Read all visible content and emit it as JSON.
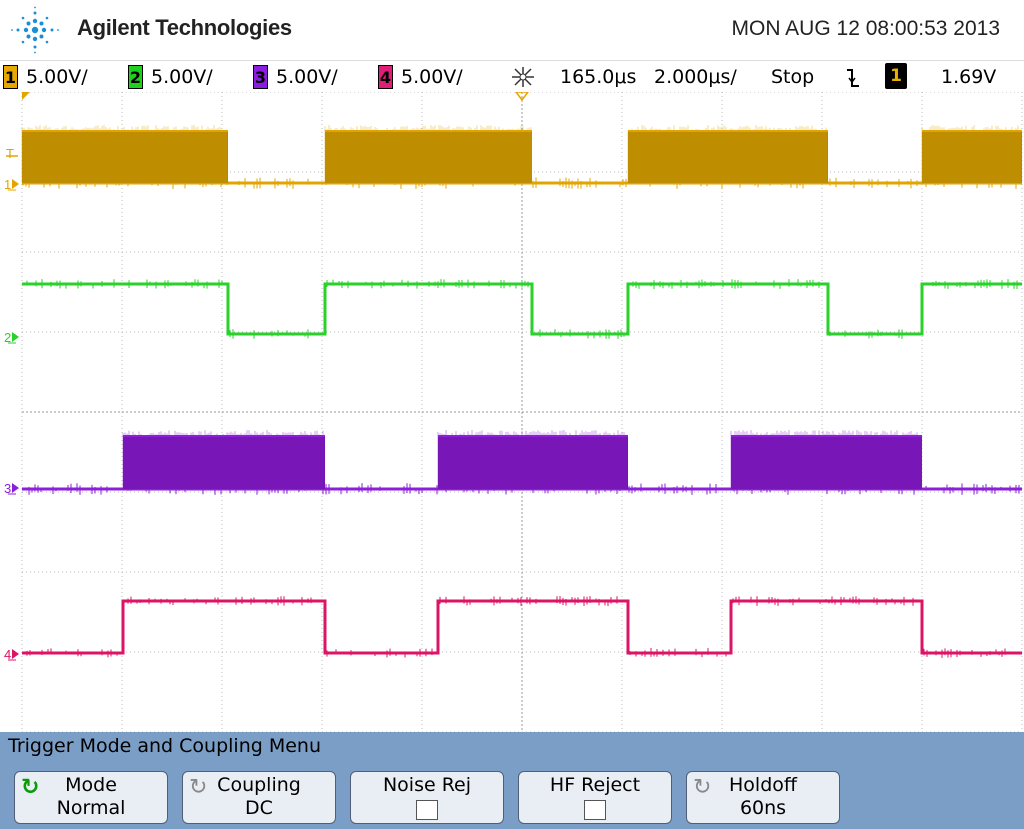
{
  "header": {
    "brand": "Agilent Technologies",
    "datetime": "MON AUG 12 08:00:53 2013",
    "logo_icon": "agilent-spark-icon"
  },
  "statusbar": {
    "channels": [
      {
        "num": "1",
        "scale": "5.00V/",
        "color": "#e6a800"
      },
      {
        "num": "2",
        "scale": "5.00V/",
        "color": "#1fd01f"
      },
      {
        "num": "3",
        "scale": "5.00V/",
        "color": "#8a1de0"
      },
      {
        "num": "4",
        "scale": "5.00V/",
        "color": "#e01e78"
      }
    ],
    "delay": "165.0μs",
    "timebase": "2.000μs/",
    "run_state": "Stop",
    "trigger_slope_icon": "falling-edge-icon",
    "trigger_source": "1",
    "trigger_level": "1.69V"
  },
  "scope": {
    "grid_color": "#b8b8b8",
    "marker_labels": {
      "trigger": "T",
      "ch1": "1",
      "ch2": "2",
      "ch3": "3",
      "ch4": "4"
    },
    "traces": [
      {
        "name": "ch1",
        "color": "#e2a400",
        "fill_color": "#b48700",
        "type": "burst"
      },
      {
        "name": "ch2",
        "color": "#28d228",
        "type": "square"
      },
      {
        "name": "ch3",
        "color": "#8c1fd8",
        "fill_color": "#7414b0",
        "type": "burst"
      },
      {
        "name": "ch4",
        "color": "#dc1466",
        "type": "square"
      }
    ]
  },
  "menu": {
    "title": "Trigger Mode and Coupling Menu",
    "softkeys": [
      {
        "name": "mode",
        "line1": "Mode",
        "line2": "Normal",
        "icon": "rotate-knob-icon"
      },
      {
        "name": "coupling",
        "line1": "Coupling",
        "line2": "DC",
        "icon": "rotate-knob-icon"
      },
      {
        "name": "noise-rej",
        "line1": "Noise Rej",
        "line2": ""
      },
      {
        "name": "hf-reject",
        "line1": "HF Reject",
        "line2": ""
      },
      {
        "name": "holdoff",
        "line1": "Holdoff",
        "line2": "60ns",
        "icon": "rotate-knob-icon"
      }
    ]
  }
}
